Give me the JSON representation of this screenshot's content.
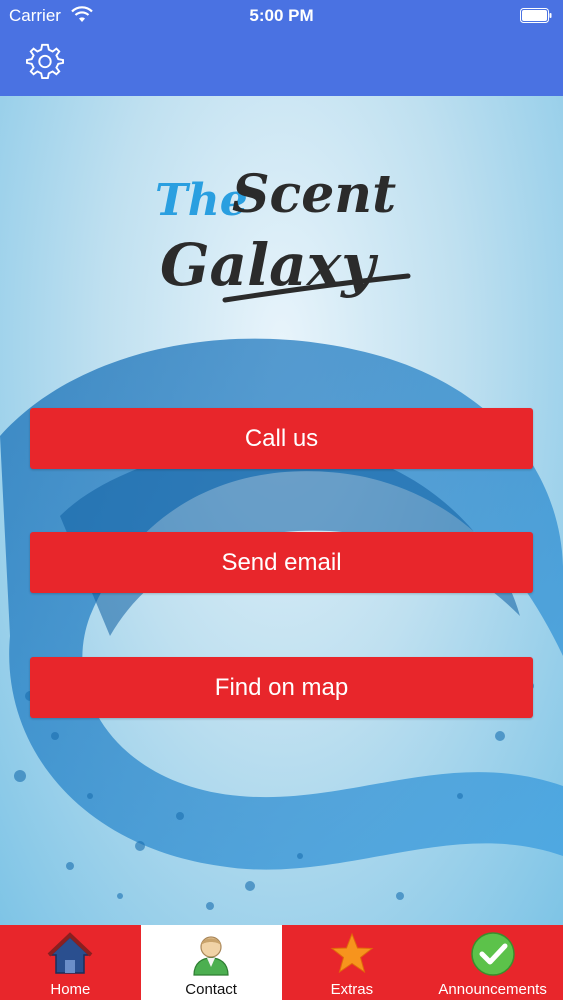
{
  "status_bar": {
    "carrier": "Carrier",
    "time": "5:00 PM"
  },
  "nav": {
    "settings_icon": "gear-icon"
  },
  "logo": {
    "line1_a": "The",
    "line1_b": "Scent",
    "line2": "Galaxy"
  },
  "actions": {
    "call_label": "Call us",
    "email_label": "Send email",
    "map_label": "Find on map"
  },
  "tabs": [
    {
      "label": "Home",
      "icon": "house-icon",
      "active": false
    },
    {
      "label": "Contact",
      "icon": "person-icon",
      "active": true
    },
    {
      "label": "Extras",
      "icon": "star-icon",
      "active": false
    },
    {
      "label": "Announcements",
      "icon": "checkmark-icon",
      "active": false
    }
  ],
  "colors": {
    "nav_bar": "#4a72e2",
    "button_red": "#e8262b",
    "tab_red": "#e8262b",
    "active_tab": "#ffffff"
  }
}
